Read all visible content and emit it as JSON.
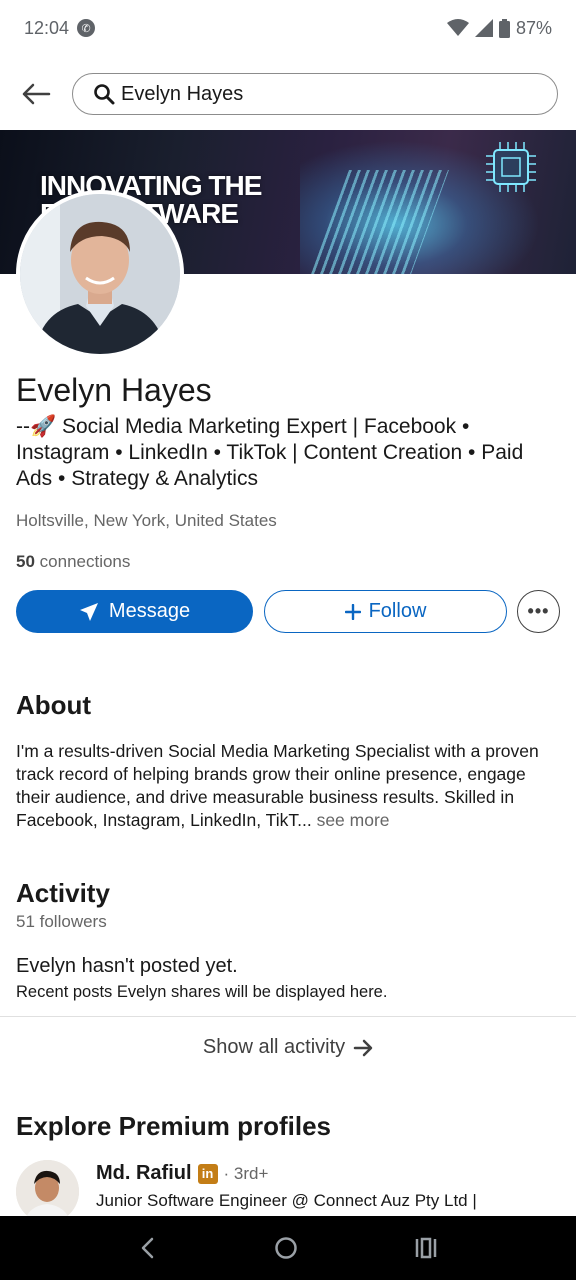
{
  "status_bar": {
    "time": "12:04",
    "battery": "87%",
    "icons": [
      "sync-badge-icon",
      "wifi-icon",
      "signal-icon",
      "battery-icon"
    ]
  },
  "search": {
    "value": "Evelyn Hayes"
  },
  "banner": {
    "line1": "INNOVATING THE",
    "line2": "F      E SOFTWARE"
  },
  "profile": {
    "name": "Evelyn Hayes",
    "headline": "--🚀 Social Media Marketing Expert | Facebook • Instagram • LinkedIn • TikTok | Content Creation • Paid Ads • Strategy & Analytics",
    "location": "Holtsville, New York, United States",
    "connections_count": "50",
    "connections_label": "connections"
  },
  "actions": {
    "message_label": "Message",
    "follow_label": "Follow",
    "more_label": "•••"
  },
  "about": {
    "title": "About",
    "text": "I'm a results-driven Social Media Marketing Specialist with a proven track record of helping brands grow their online presence, engage their audience, and drive measurable business results. Skilled in Facebook, Instagram, LinkedIn, TikT...",
    "see_more": "see more"
  },
  "activity": {
    "title": "Activity",
    "followers": "51 followers",
    "empty_title": "Evelyn hasn't posted yet.",
    "empty_subtitle": "Recent posts Evelyn shares will be displayed here.",
    "show_all": "Show all activity"
  },
  "premium": {
    "title": "Explore Premium profiles",
    "profiles": [
      {
        "name": "Md. Rafiul",
        "badge": "in",
        "degree": "· 3rd+",
        "headline": "Junior Software Engineer @ Connect Auz Pty Ltd |"
      }
    ]
  },
  "colors": {
    "primary": "#0a66c2",
    "text": "#191919",
    "muted": "#666666",
    "premium_badge": "#c37d16"
  }
}
